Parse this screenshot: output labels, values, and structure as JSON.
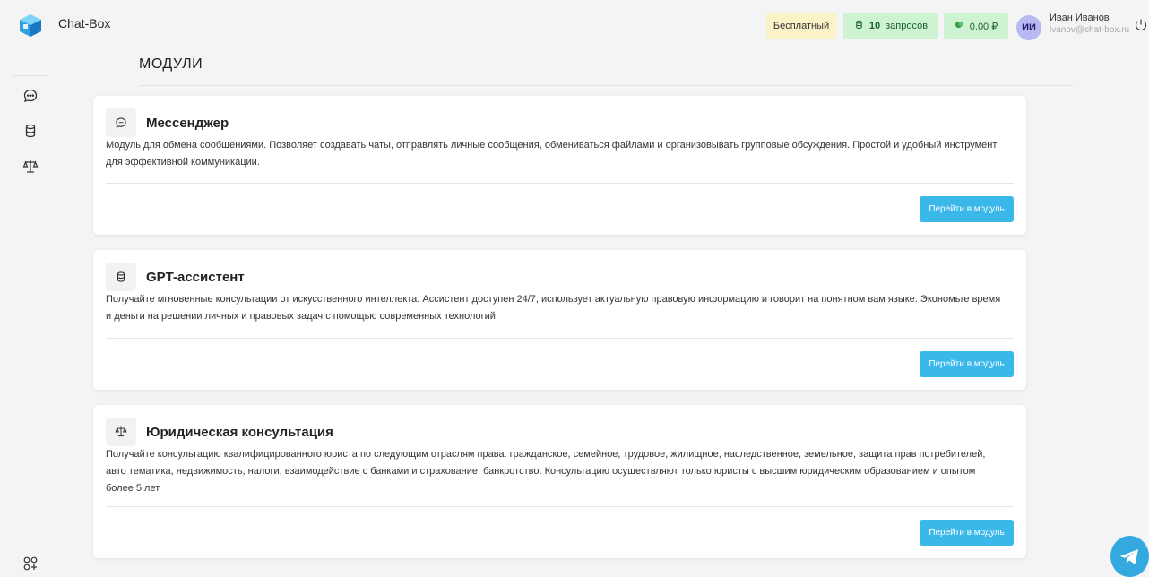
{
  "app": {
    "title": "Chat-Box"
  },
  "header": {
    "plan": "Бесплатный",
    "requests_count": "10",
    "requests_label": "запросов",
    "balance": "0.00 ₽",
    "user": {
      "initials": "ИИ",
      "name": "Иван Иванов",
      "email": "ivanov@chat-box.ru"
    }
  },
  "page": {
    "title": "МОДУЛИ"
  },
  "modules": [
    {
      "icon": "chat-bubble-icon",
      "title": "Мессенджер",
      "desc_line1": "Модуль для обмена сообщениями. Позволяет создавать чаты, отправлять личные сообщения, обмениваться файлами и организовывать групповые обсуждения. Простой и удобный инструмент",
      "desc_line2": "для эффективной коммуникации.",
      "button": "Перейти в модуль"
    },
    {
      "icon": "database-icon",
      "title": "GPT-ассистент",
      "desc_line1": "Получайте мгновенные консультации от искусственного интеллекта. Ассистент доступен 24/7, использует актуальную правовую информацию и говорит на понятном вам языке. Экономьте время",
      "desc_line2": "и деньги на решении личных и правовых задач с помощью современных технологий.",
      "button": "Перейти в модуль"
    },
    {
      "icon": "scales-icon",
      "title": "Юридическая консультация",
      "desc_line1": "Получайте консультацию квалифицированного юриста по следующим отраслям права: гражданское, семейное, трудовое, жилищное, наследственное, земельное, защита прав потребителей,",
      "desc_line2": "авто тематика, недвижимость, налоги, взаимодействие с банками и страхование, банкротство. Консультацию осуществляют только юристы с высшим юридическим образованием и опытом",
      "desc_line3": "более 5 лет.",
      "button": "Перейти в модуль"
    }
  ],
  "colors": {
    "accent": "#3bb8ea",
    "plan_bg": "#fbf3c8",
    "green_bg": "#cdf3d2",
    "avatar_bg": "#b8b9f0"
  }
}
